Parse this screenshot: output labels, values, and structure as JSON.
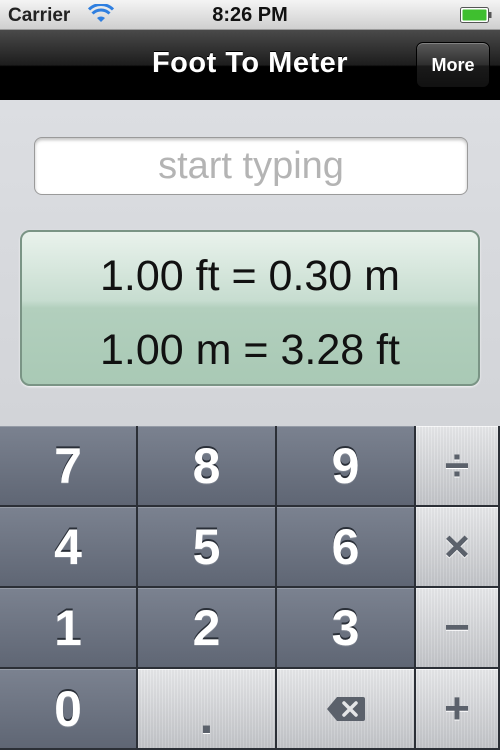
{
  "status_bar": {
    "carrier": "Carrier",
    "time": "8:26 PM"
  },
  "nav": {
    "title": "Foot To Meter",
    "more_label": "More"
  },
  "input": {
    "placeholder": "start typing",
    "value": ""
  },
  "results": {
    "ft_to_m": "1.00 ft = 0.30 m",
    "m_to_ft": "1.00 m = 3.28 ft"
  },
  "keypad": {
    "k7": "7",
    "k8": "8",
    "k9": "9",
    "divide": "÷",
    "k4": "4",
    "k5": "5",
    "k6": "6",
    "multiply": "×",
    "k1": "1",
    "k2": "2",
    "k3": "3",
    "minus": "−",
    "k0": "0",
    "dot": ".",
    "plus": "+"
  },
  "colors": {
    "nav_bg": "#000000",
    "result_panel": "#b2cfbd",
    "dark_key": "#6b7280",
    "light_key": "#d6d7da"
  },
  "icons": {
    "wifi": "wifi-icon",
    "battery": "battery-icon",
    "backspace": "backspace-icon"
  }
}
